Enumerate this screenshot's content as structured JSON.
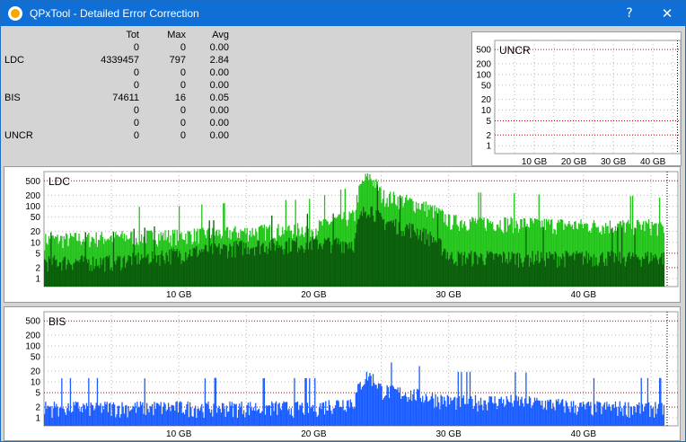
{
  "window": {
    "title": "QPxTool - Detailed Error Correction",
    "help_label": "?",
    "close_label": "✕"
  },
  "stats": {
    "headers": [
      "",
      "Tot",
      "Max",
      "Avg"
    ],
    "rows": [
      [
        "",
        "0",
        "0",
        "0.00"
      ],
      [
        "LDC",
        "4339457",
        "797",
        "2.84"
      ],
      [
        "",
        "0",
        "0",
        "0.00"
      ],
      [
        "",
        "0",
        "0",
        "0.00"
      ],
      [
        "BIS",
        "74611",
        "16",
        "0.05"
      ],
      [
        "",
        "0",
        "0",
        "0.00"
      ],
      [
        "",
        "0",
        "0",
        "0.00"
      ],
      [
        "UNCR",
        "0",
        "0",
        "0.00"
      ]
    ]
  },
  "colors": {
    "titlebar": "#0f6fd6",
    "ldc_light": "#22c41a",
    "ldc_dark": "#0b5d0b",
    "bis_light": "#1a5cff",
    "bis_dark": "#0a2a78",
    "threshold": "#c00000",
    "grid": "#b8b8b8"
  },
  "chart_data": [
    {
      "type": "area",
      "title": "UNCR",
      "y_scale": "log",
      "y_ticks": [
        "500",
        "200",
        "100",
        "50",
        "20",
        "10",
        "5",
        "2",
        "1"
      ],
      "x_ticks": [
        "10 GB",
        "20 GB",
        "30 GB",
        "40 GB"
      ],
      "x_range_gb": [
        0,
        47
      ],
      "series": [
        {
          "values": [
            0
          ]
        }
      ]
    },
    {
      "type": "area",
      "title": "LDC",
      "y_scale": "log",
      "y_ticks": [
        "500",
        "200",
        "100",
        "50",
        "20",
        "10",
        "5",
        "2",
        "1"
      ],
      "x_ticks": [
        "10 GB",
        "20 GB",
        "30 GB",
        "40 GB"
      ],
      "x_range_gb": [
        0,
        47
      ],
      "series": [
        {
          "x_gb": [
            0,
            5,
            10,
            15,
            20,
            23,
            24,
            25,
            30,
            35,
            40,
            45,
            47
          ],
          "values": [
            12,
            14,
            16,
            20,
            25,
            55,
            700,
            200,
            40,
            35,
            30,
            30,
            20
          ]
        },
        {
          "x_gb": [
            0,
            5,
            10,
            15,
            20,
            23,
            24,
            25,
            30,
            35,
            40,
            45,
            47
          ],
          "values": [
            3,
            3,
            5,
            8,
            10,
            10,
            100,
            40,
            4,
            4,
            4,
            4,
            4
          ]
        }
      ]
    },
    {
      "type": "area",
      "title": "BIS",
      "y_scale": "log",
      "y_ticks": [
        "500",
        "200",
        "100",
        "50",
        "20",
        "10",
        "5",
        "2",
        "1"
      ],
      "x_ticks": [
        "10 GB",
        "20 GB",
        "30 GB",
        "40 GB"
      ],
      "x_range_gb": [
        0,
        47
      ],
      "series": [
        {
          "x_gb": [
            0,
            5,
            10,
            15,
            20,
            23,
            24,
            25,
            30,
            35,
            40,
            45,
            47
          ],
          "values": [
            2,
            2,
            2,
            2,
            2,
            3,
            16,
            6,
            3,
            3,
            2,
            2,
            2
          ]
        }
      ]
    }
  ]
}
